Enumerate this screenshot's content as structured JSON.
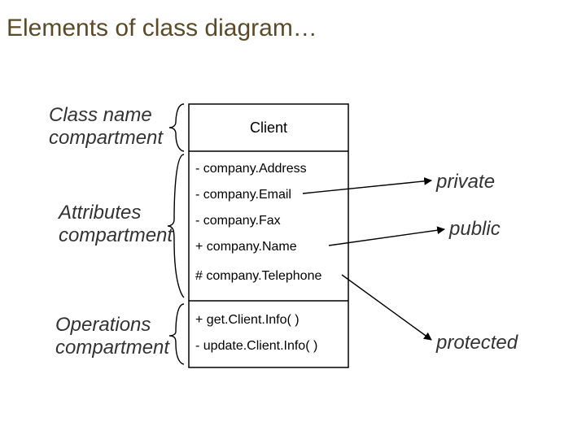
{
  "title": "Elements of class diagram…",
  "labels": {
    "className": "Class name compartment",
    "attributes": "Attributes compartment",
    "operations": "Operations compartment",
    "private": "private",
    "public": "public",
    "protected": "protected"
  },
  "classBox": {
    "name": "Client",
    "attributes": [
      "- company.Address",
      "- company.Email",
      "- company.Fax",
      "+ company.Name",
      "# company.Telephone"
    ],
    "operations": [
      "+ get.Client.Info( )",
      "- update.Client.Info( )"
    ]
  }
}
